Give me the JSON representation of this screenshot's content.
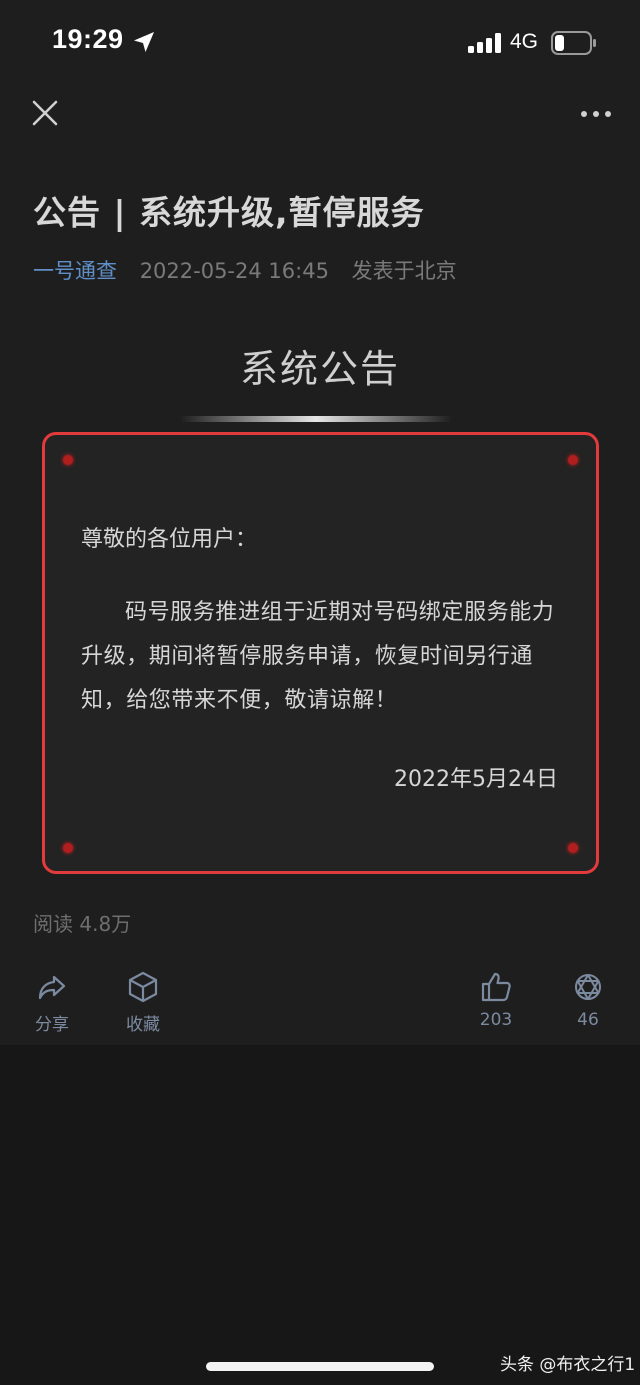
{
  "status_bar": {
    "time": "19:29",
    "network": "4G"
  },
  "nav": {
    "close_icon": "close-icon",
    "more_icon": "more-icon"
  },
  "article": {
    "title": "公告 | 系统升级,暂停服务",
    "author": "一号通查",
    "date": "2022-05-24 16:45",
    "location": "发表于北京"
  },
  "banner": {
    "title": "系统公告"
  },
  "notice": {
    "greeting": "尊敬的各位用户：",
    "body": "码号服务推进组于近期对号码绑定服务能力升级，期间将暂停服务申请，恢复时间另行通知，给您带来不便，敬请谅解！",
    "date": "2022年5月24日",
    "border_color": "#e23b3b"
  },
  "stats": {
    "reads": "阅读 4.8万"
  },
  "actions": {
    "share": "分享",
    "favorite": "收藏",
    "likes": "203",
    "shares_count": "46"
  },
  "watermark": "头条 @布衣之行1",
  "colors": {
    "background": "#1e1e1e",
    "author_link": "#5f8fc6",
    "accent_red": "#e23b3b"
  }
}
